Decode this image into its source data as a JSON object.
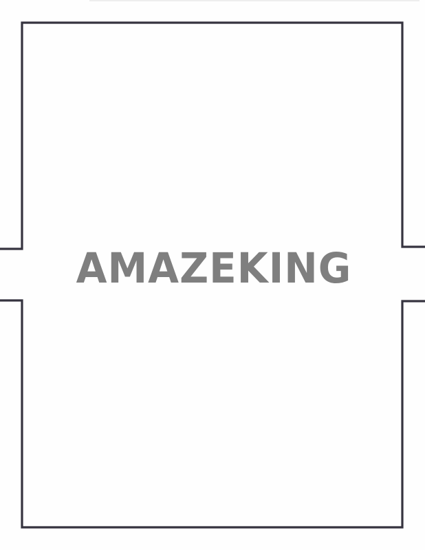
{
  "title": {
    "text": "AMAZEKING"
  },
  "colors": {
    "background": "#ffffff",
    "frame_line": "#35333f",
    "title_text": "#7f7f7f"
  }
}
